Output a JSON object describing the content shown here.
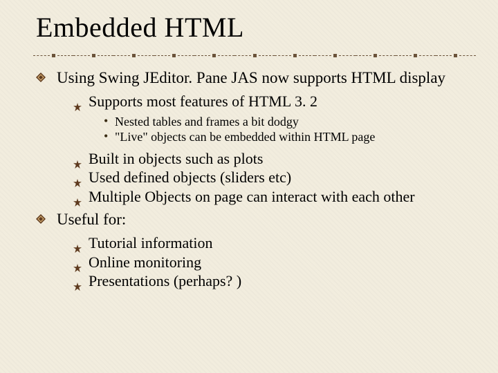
{
  "title": "Embedded HTML",
  "colors": {
    "bullet": "#5e3a1e",
    "bullet_dark": "#3a220e",
    "divider": "#6b533a"
  },
  "bullets": {
    "items": [
      {
        "text": "Using Swing JEditor. Pane JAS now supports HTML display",
        "children": [
          {
            "text": "Supports most features of HTML 3. 2",
            "children": [
              {
                "text": "Nested tables and frames a bit dodgy"
              },
              {
                "text": "\"Live\" objects can be embedded within HTML page"
              }
            ]
          },
          {
            "text": "Built in objects such as plots"
          },
          {
            "text": "Used defined objects (sliders etc)"
          },
          {
            "text": "Multiple Objects on page can interact with each other"
          }
        ]
      },
      {
        "text": "Useful for:",
        "children": [
          {
            "text": "Tutorial information"
          },
          {
            "text": "Online monitoring"
          },
          {
            "text": "Presentations (perhaps? )"
          }
        ]
      }
    ]
  }
}
